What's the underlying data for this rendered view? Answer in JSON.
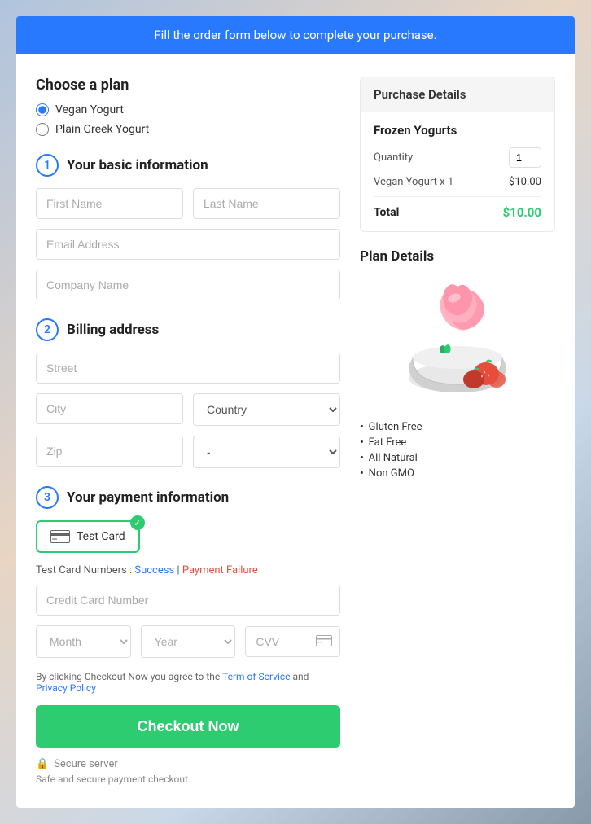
{
  "banner": {
    "text": "Fill the order form below to complete your purchase."
  },
  "plan": {
    "heading": "Choose a plan",
    "options": [
      {
        "label": "Vegan Yogurt",
        "value": "vegan",
        "checked": true
      },
      {
        "label": "Plain Greek Yogurt",
        "value": "greek",
        "checked": false
      }
    ]
  },
  "sections": {
    "basic_info": {
      "step": "1",
      "title": "Your basic information",
      "fields": {
        "first_name_placeholder": "First Name",
        "last_name_placeholder": "Last Name",
        "email_placeholder": "Email Address",
        "company_placeholder": "Company Name"
      }
    },
    "billing": {
      "step": "2",
      "title": "Billing address",
      "fields": {
        "street_placeholder": "Street",
        "city_placeholder": "City",
        "country_placeholder": "Country",
        "zip_placeholder": "Zip",
        "state_placeholder": "-"
      }
    },
    "payment": {
      "step": "3",
      "title": "Your payment information",
      "card_label": "Test Card",
      "test_card_note": "Test Card Numbers :",
      "success_link": "Success",
      "separator": "|",
      "failure_link": "Payment Failure",
      "cc_placeholder": "Credit Card Number",
      "month_label": "Month",
      "year_label": "Year",
      "cvv_placeholder": "CVV"
    }
  },
  "terms": {
    "text_before": "By clicking Checkout Now you agree to the ",
    "tos_label": "Term of Service",
    "and": " and ",
    "privacy_label": "Privacy Policy"
  },
  "checkout": {
    "button_label": "Checkout Now",
    "secure_label": "Secure server",
    "safe_text": "Safe and secure payment checkout."
  },
  "purchase_details": {
    "header": "Purchase Details",
    "product_name": "Frozen Yogurts",
    "quantity_label": "Quantity",
    "quantity_value": "1",
    "line_item_label": "Vegan Yogurt x 1",
    "line_item_price": "$10.00",
    "total_label": "Total",
    "total_price": "$10.00"
  },
  "plan_details": {
    "heading": "Plan Details",
    "features": [
      "Gluten Free",
      "Fat Free",
      "All Natural",
      "Non GMO"
    ]
  },
  "icons": {
    "lock": "🔒",
    "credit_card": "💳",
    "checkmark": "✓"
  }
}
